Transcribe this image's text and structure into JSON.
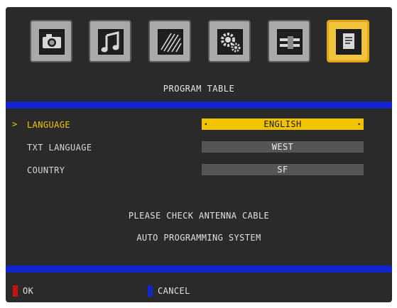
{
  "icons": [
    {
      "name": "picture-icon"
    },
    {
      "name": "music-icon"
    },
    {
      "name": "channel-icon"
    },
    {
      "name": "setup-icon"
    },
    {
      "name": "connection-icon"
    },
    {
      "name": "document-icon",
      "selected": true
    }
  ],
  "header": {
    "title": "PROGRAM TABLE"
  },
  "menu": {
    "cursor": ">",
    "rows": [
      {
        "label": "LANGUAGE",
        "value": "ENGLISH",
        "active": true
      },
      {
        "label": "TXT LANGUAGE",
        "value": "WEST"
      },
      {
        "label": "COUNTRY",
        "value": "SF"
      }
    ]
  },
  "messages": [
    "PLEASE CHECK ANTENNA CABLE",
    "AUTO PROGRAMMING SYSTEM"
  ],
  "footer": {
    "ok": {
      "label": "OK",
      "color": "#cc1111"
    },
    "cancel": {
      "label": "CANCEL",
      "color": "#1424cc"
    }
  },
  "colors": {
    "accent": "#f2c400",
    "bar": "#1424cc",
    "background": "#2a2a2a"
  }
}
